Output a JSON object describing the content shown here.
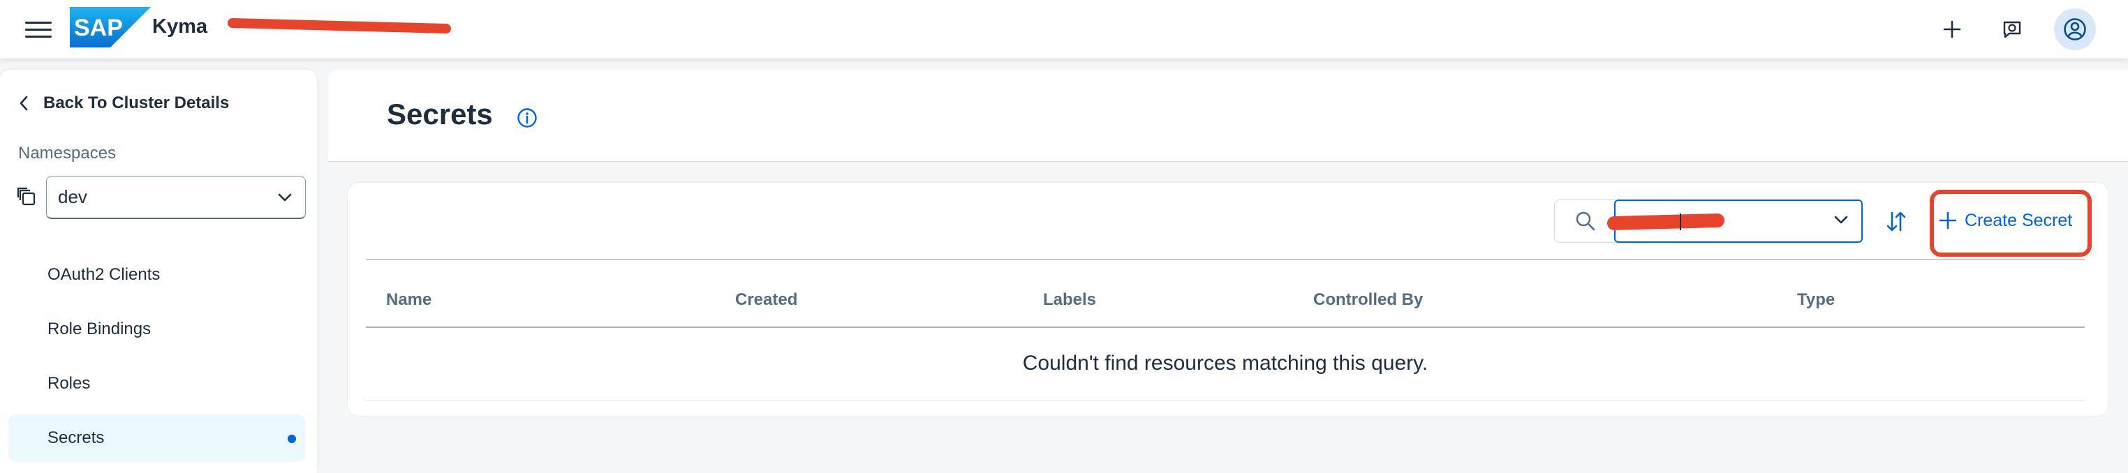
{
  "shell": {
    "product_name": "Kyma",
    "logo_text": "SAP",
    "icons": [
      "menu-icon",
      "sap-logo",
      "add-icon",
      "feedback-icon",
      "user-avatar-icon"
    ],
    "colors": {
      "brand": "#0a6ed1",
      "accent": "#0064d9",
      "redaction": "#e8442c"
    }
  },
  "sidebar": {
    "back_label": "Back To Cluster Details",
    "namespaces_label": "Namespaces",
    "namespace_value": "dev",
    "items": [
      {
        "label": "OAuth2 Clients",
        "active": false
      },
      {
        "label": "Role Bindings",
        "active": false
      },
      {
        "label": "Roles",
        "active": false
      },
      {
        "label": "Secrets",
        "active": true
      }
    ]
  },
  "page": {
    "title": "Secrets"
  },
  "toolbar": {
    "create_label": "Create Secret"
  },
  "table": {
    "columns": [
      "Name",
      "Created",
      "Labels",
      "Controlled By",
      "Type"
    ],
    "empty_message": "Couldn't find resources matching this query."
  }
}
